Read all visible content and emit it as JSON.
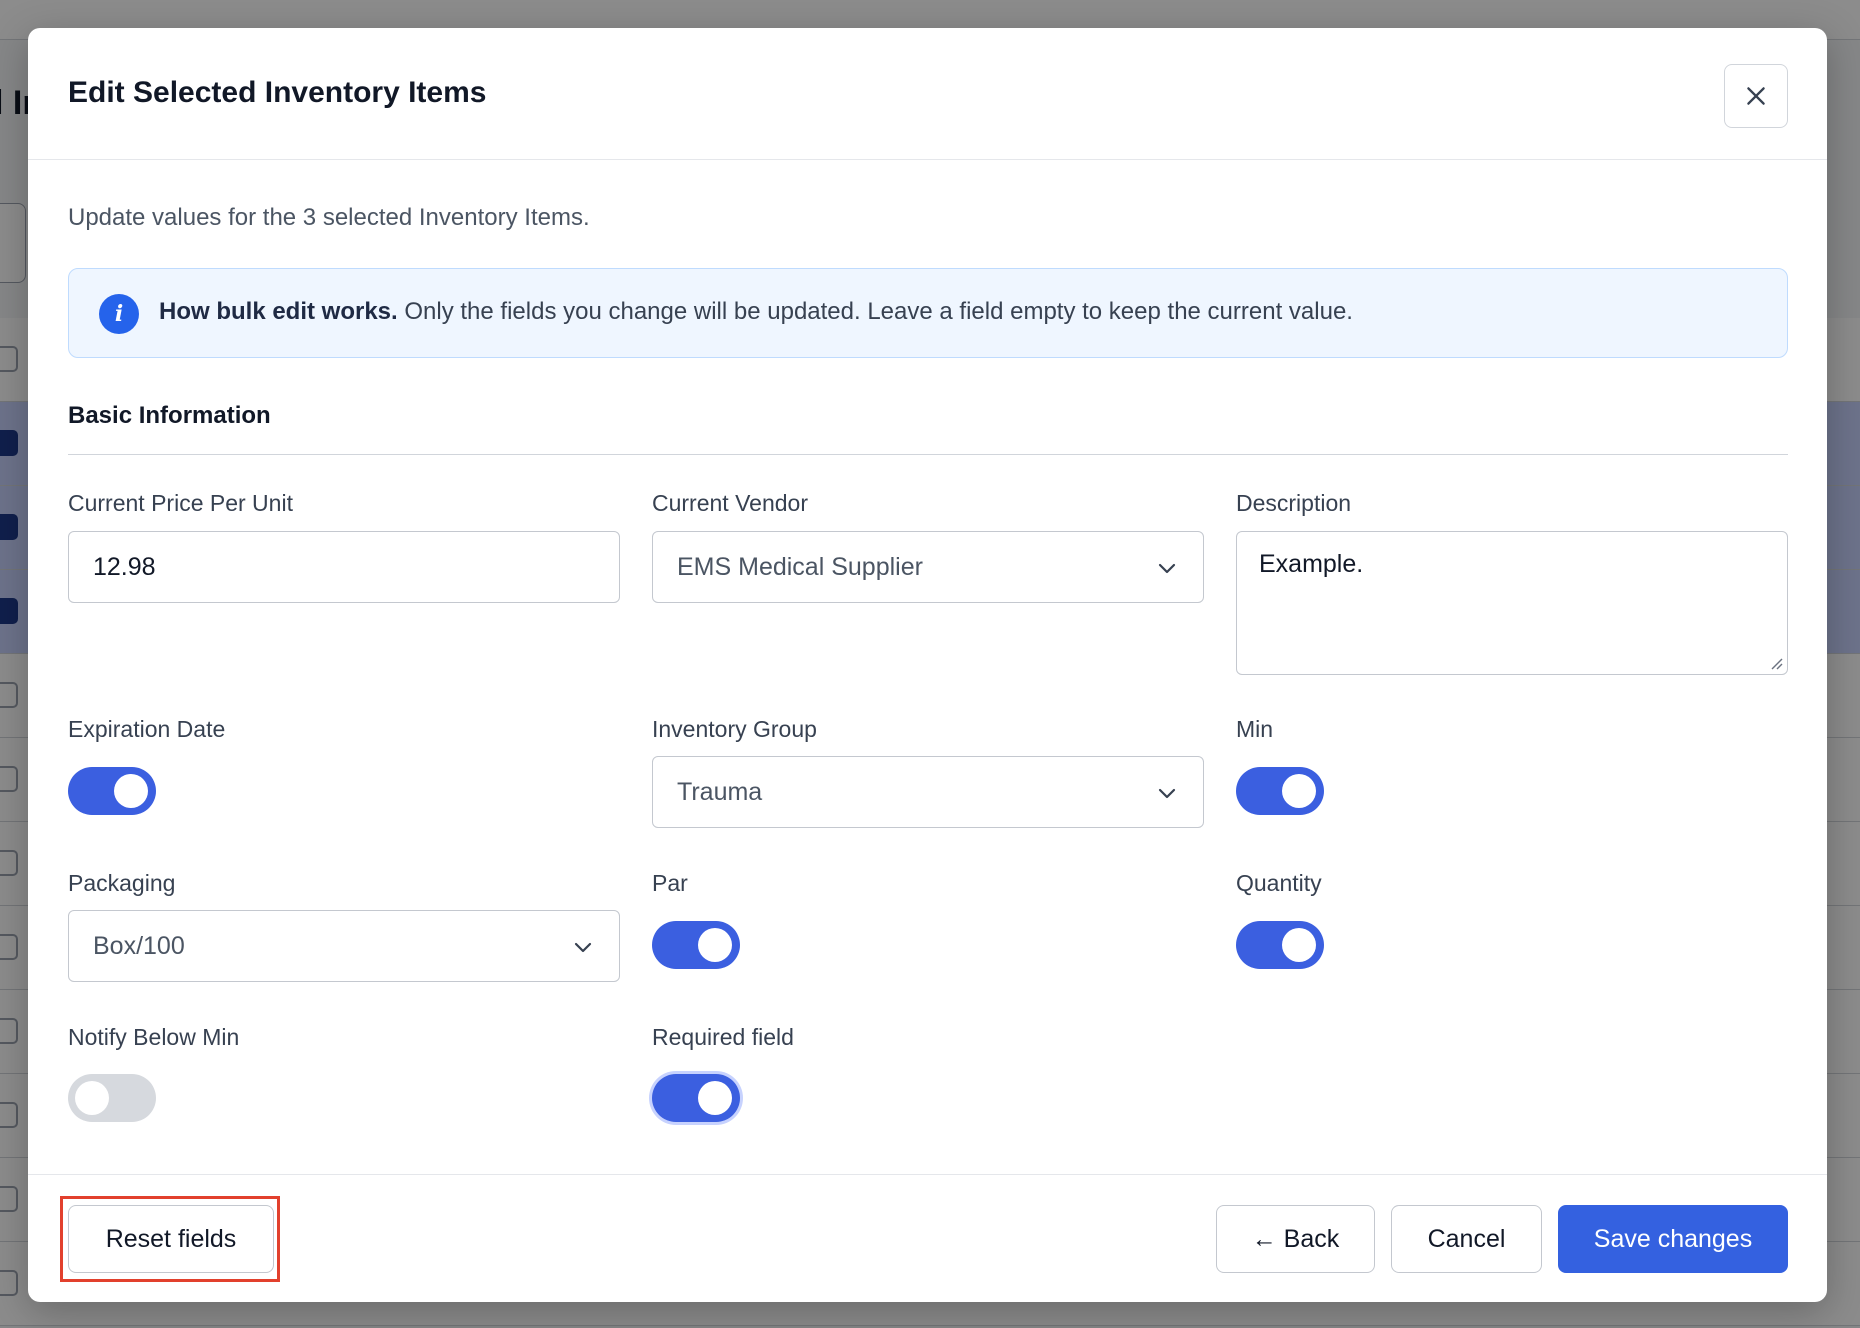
{
  "background": {
    "title_fragment": "l In"
  },
  "modal": {
    "title": "Edit Selected Inventory Items",
    "subtitle": "Update values for the 3 selected Inventory Items.",
    "info": {
      "bold": "How bulk edit works.",
      "text": " Only the fields you change will be updated. Leave a field empty to keep the current value."
    },
    "section_title": "Basic Information",
    "fields": {
      "price": {
        "label": "Current Price Per Unit",
        "value": "12.98"
      },
      "vendor": {
        "label": "Current Vendor",
        "value": "EMS Medical Supplier"
      },
      "description": {
        "label": "Description",
        "value": "Example."
      },
      "expiration": {
        "label": "Expiration Date",
        "enabled": true
      },
      "group": {
        "label": "Inventory Group",
        "value": "Trauma"
      },
      "min": {
        "label": "Min",
        "enabled": true
      },
      "packaging": {
        "label": "Packaging",
        "value": "Box/100"
      },
      "par": {
        "label": "Par",
        "enabled": true
      },
      "quantity": {
        "label": "Quantity",
        "enabled": true
      },
      "notify": {
        "label": "Notify Below Min",
        "enabled": false
      },
      "required": {
        "label": "Required field",
        "enabled": true
      }
    },
    "footer": {
      "reset_label": "Reset fields",
      "back_label": "← Back",
      "cancel_label": "Cancel",
      "save_label": "Save changes"
    }
  },
  "colors": {
    "accent": "#3461e0",
    "highlight": "#e2402d",
    "info_bg": "#eff6ff"
  }
}
